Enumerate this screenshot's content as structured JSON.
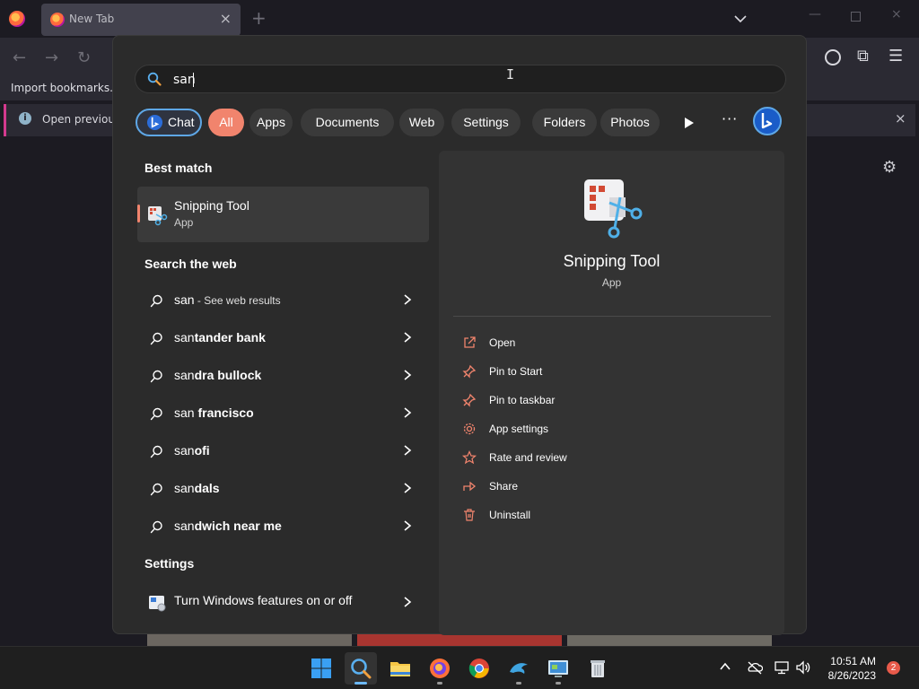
{
  "browser": {
    "tab_title": "New Tab",
    "bookmarks_import": "Import bookmarks...",
    "notice_text": "Open previous"
  },
  "search": {
    "query": "san",
    "filters": {
      "chat": "Chat",
      "all": "All",
      "apps": "Apps",
      "documents": "Documents",
      "web": "Web",
      "settings": "Settings",
      "folders": "Folders",
      "photos": "Photos",
      "more": "···"
    },
    "best_match_heading": "Best match",
    "best_match": {
      "name": "Snipping Tool",
      "type": "App"
    },
    "web_heading": "Search the web",
    "web_results": [
      {
        "match": "san",
        "rest": "",
        "suffix": " - See web results"
      },
      {
        "match": "san",
        "rest": "tander bank",
        "suffix": ""
      },
      {
        "match": "san",
        "rest": "dra bullock",
        "suffix": ""
      },
      {
        "match": "san",
        "rest": " francisco",
        "suffix": ""
      },
      {
        "match": "san",
        "rest": "ofi",
        "suffix": ""
      },
      {
        "match": "san",
        "rest": "dals",
        "suffix": ""
      },
      {
        "match": "san",
        "rest": "dwich near me",
        "suffix": ""
      }
    ],
    "settings_heading": "Settings",
    "settings_result": "Turn Windows features on or off",
    "preview": {
      "name": "Snipping Tool",
      "type": "App",
      "actions": [
        {
          "label": "Open",
          "icon": "open-external-icon"
        },
        {
          "label": "Pin to Start",
          "icon": "pin-icon"
        },
        {
          "label": "Pin to taskbar",
          "icon": "pin-icon"
        },
        {
          "label": "App settings",
          "icon": "gear-icon"
        },
        {
          "label": "Rate and review",
          "icon": "star-icon"
        },
        {
          "label": "Share",
          "icon": "share-icon"
        },
        {
          "label": "Uninstall",
          "icon": "trash-icon"
        }
      ]
    }
  },
  "taskbar": {
    "time": "10:51 AM",
    "date": "8/26/2023",
    "notification_count": "2"
  },
  "colors": {
    "accent": "#f1846d",
    "chat_border": "#5ea7e6",
    "panel_bg": "#2b2b2b",
    "preview_bg": "#333333"
  }
}
